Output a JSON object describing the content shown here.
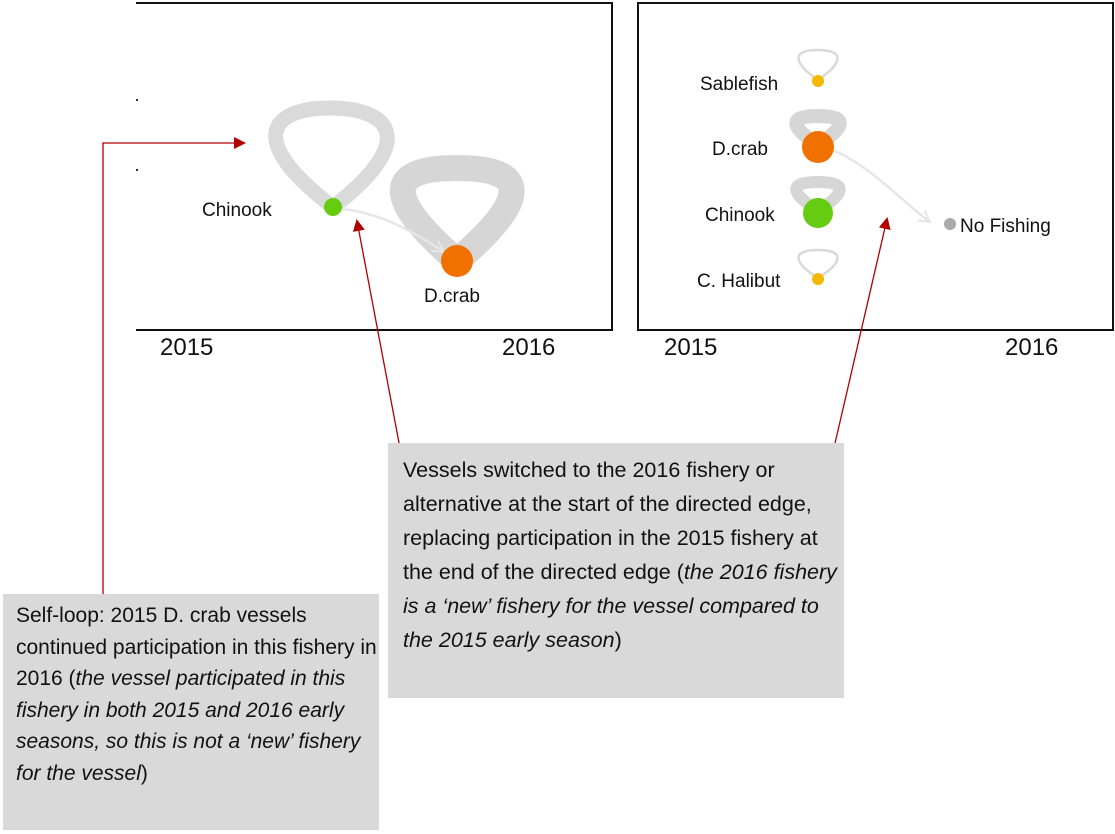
{
  "colors": {
    "chinook": "#66cc11",
    "dcrab": "#f07000",
    "sablefish": "#f5b800",
    "halibut": "#f5b800",
    "no_fishing": "#aaaaaa",
    "edge": "#d9d9d9",
    "annotation_arrow": "#b00000",
    "callout_bg": "#d9d9d9"
  },
  "left_panel": {
    "year_start": "2015",
    "year_end": "2016",
    "nodes": {
      "chinook": "Chinook",
      "dcrab": "D.crab"
    }
  },
  "right_panel": {
    "year_start": "2015",
    "year_end": "2016",
    "nodes": {
      "sablefish": "Sablefish",
      "dcrab": "D.crab",
      "chinook": "Chinook",
      "halibut": "C. Halibut",
      "no_fishing": "No Fishing"
    }
  },
  "callouts": {
    "switch": {
      "line1": "Vessels switched to the 2016 fishery or alternative at the start of the directed edge, replacing participation in the 2015 fishery at the end of the directed edge (",
      "italic": "the 2016 fishery is a ‘new’ fishery for the vessel compared to the 2015 early season",
      "end": ")"
    },
    "self_loop": {
      "line1": "Self-loop: 2015 D. crab vessels continued participation in this fishery in 2016 (",
      "italic": "the vessel participated in this fishery in both 2015 and 2016 early seasons, so this is not a ‘new’ fishery for the vessel",
      "end": ")"
    }
  }
}
